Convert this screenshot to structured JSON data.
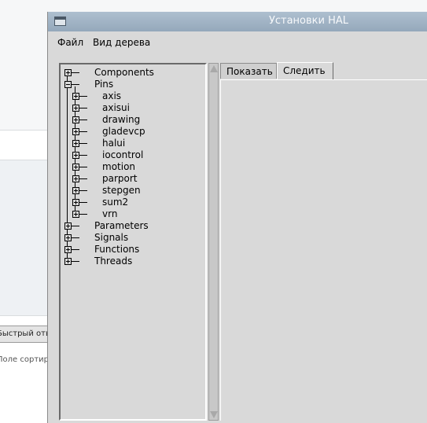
{
  "background": {
    "tab_label": "Быстрый ответ",
    "sort_text": "Поле сортировки"
  },
  "window": {
    "title": "Установки HAL"
  },
  "menu": {
    "file": "Файл",
    "tree_view": "Вид дерева"
  },
  "tree": {
    "components": "Components",
    "pins": "Pins",
    "pin_children": [
      "axis",
      "axisui",
      "drawing",
      "gladevcp",
      "halui",
      "iocontrol",
      "motion",
      "parport",
      "stepgen",
      "sum2",
      "vrn"
    ],
    "parameters": "Parameters",
    "signals": "Signals",
    "functions": "Functions",
    "threads": "Threads"
  },
  "tabs": {
    "show": "Показать",
    "watch": "Следить"
  }
}
